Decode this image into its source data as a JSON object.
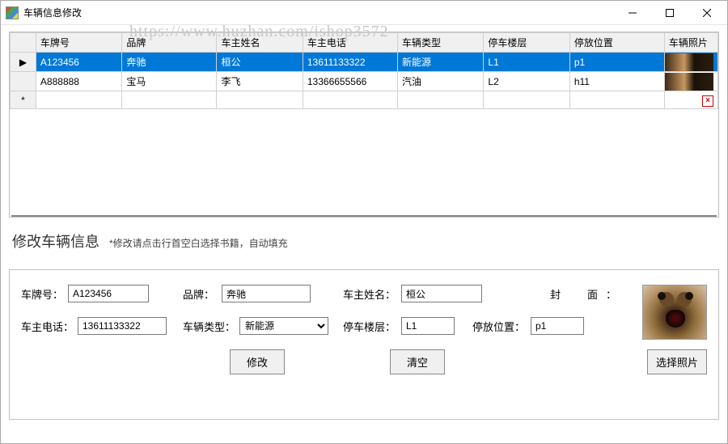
{
  "window": {
    "title": "车辆信息修改"
  },
  "watermark": "https://www.huzhan.com/ishop3572",
  "grid": {
    "columns": [
      "车牌号",
      "品牌",
      "车主姓名",
      "车主电话",
      "车辆类型",
      "停车楼层",
      "停放位置",
      "车辆照片"
    ],
    "rows": [
      {
        "selected": true,
        "indicator": "▶",
        "cells": [
          "A123456",
          "奔驰",
          "桓公",
          "13611133322",
          "新能源",
          "L1",
          "p1"
        ],
        "hasPhoto": true
      },
      {
        "selected": false,
        "indicator": "",
        "cells": [
          "A888888",
          "宝马",
          "李飞",
          "13366655566",
          "汽油",
          "L2",
          "h11"
        ],
        "hasPhoto": true
      },
      {
        "selected": false,
        "indicator": "*",
        "cells": [
          "",
          "",
          "",
          "",
          "",
          "",
          ""
        ],
        "hasPhoto": false
      }
    ]
  },
  "form": {
    "title": "修改车辆信息",
    "hint": "*修改请点击行首空白选择书籍，自动填充",
    "labels": {
      "plate": "车牌号：",
      "brand": "品牌：",
      "ownerName": "车主姓名：",
      "ownerPhone": "车主电话：",
      "vehicleType": "车辆类型：",
      "floor": "停车楼层：",
      "position": "停放位置：",
      "cover": "封　面："
    },
    "values": {
      "plate": "A123456",
      "brand": "奔驰",
      "ownerName": "桓公",
      "ownerPhone": "13611133322",
      "vehicleType": "新能源",
      "floor": "L1",
      "position": "p1"
    },
    "buttons": {
      "modify": "修改",
      "clear": "清空",
      "choosePhoto": "选择照片"
    }
  }
}
